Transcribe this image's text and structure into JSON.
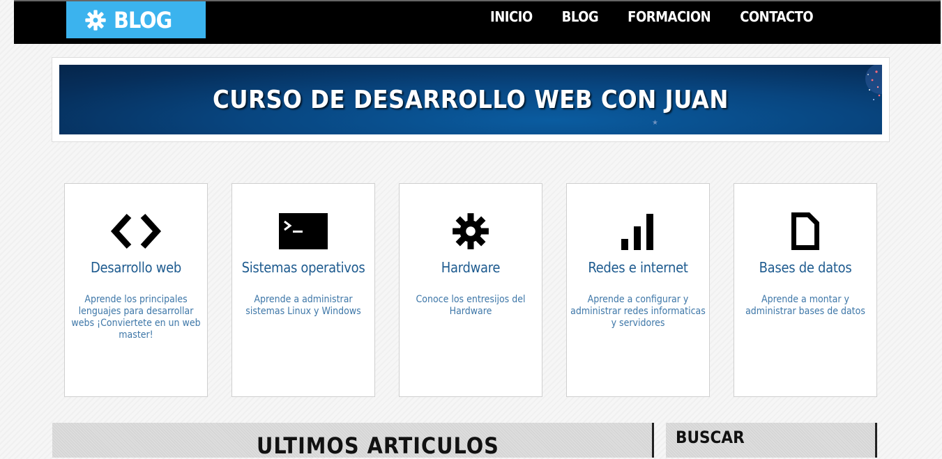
{
  "header": {
    "logo_text": "BLOG",
    "logo_icon": "gear-icon",
    "nav": [
      "INICIO",
      "BLOG",
      "FORMACION",
      "CONTACTO"
    ]
  },
  "hero": {
    "title": "CURSO DE DESARROLLO WEB CON JUAN"
  },
  "cards": [
    {
      "icon": "code-icon",
      "title": "Desarrollo web",
      "desc": "Aprende los principales lenguajes para desarrollar webs ¡Conviertete en un web master!"
    },
    {
      "icon": "terminal-icon",
      "title": "Sistemas operativos",
      "desc": "Aprende a administrar sistemas Linux y Windows"
    },
    {
      "icon": "gear-icon",
      "title": "Hardware",
      "desc": "Conoce los entresijos del Hardware"
    },
    {
      "icon": "signal-bars-icon",
      "title": "Redes e internet",
      "desc": "Aprende a configurar y administrar redes informaticas y servidores"
    },
    {
      "icon": "document-icon",
      "title": "Bases de datos",
      "desc": "Aprende a montar y administrar bases de datos"
    }
  ],
  "sections": {
    "articles_title": "ULTIMOS ARTICULOS",
    "search_title": "BUSCAR"
  },
  "colors": {
    "logo_bg": "#3bb3ee",
    "header_bg": "#000000",
    "card_title": "#1e5b8f",
    "card_desc": "#3e77a8"
  }
}
